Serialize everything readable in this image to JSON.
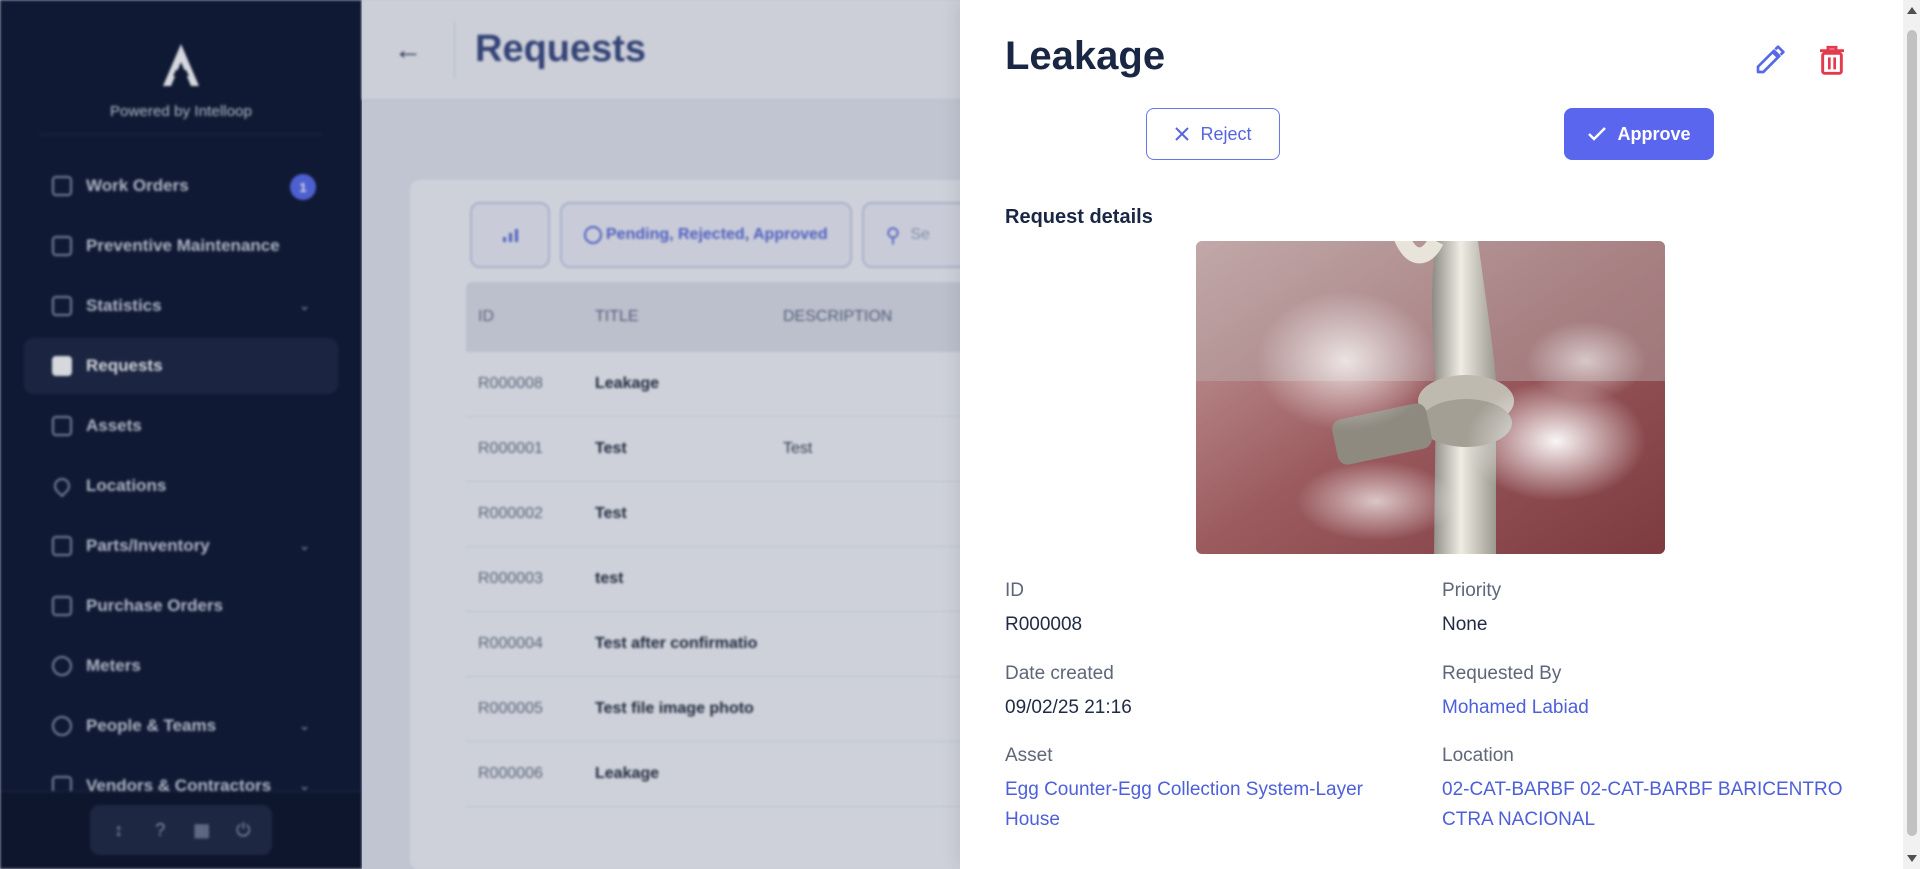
{
  "sidebar": {
    "powered_by": "Powered by Intelloop",
    "items": [
      {
        "label": "Work Orders",
        "badge": "1"
      },
      {
        "label": "Preventive Maintenance"
      },
      {
        "label": "Statistics"
      },
      {
        "label": "Requests"
      },
      {
        "label": "Assets"
      },
      {
        "label": "Locations"
      },
      {
        "label": "Parts/Inventory"
      },
      {
        "label": "Purchase Orders"
      },
      {
        "label": "Meters"
      },
      {
        "label": "People & Teams"
      },
      {
        "label": "Vendors & Contractors"
      }
    ],
    "bottom_icons": [
      "import-icon",
      "help-icon",
      "calendar-icon",
      "power-icon"
    ]
  },
  "main": {
    "title": "Requests",
    "filter_status": "Pending, Rejected, Approved",
    "search_placeholder": "Se",
    "columns": [
      "ID",
      "TITLE",
      "DESCRIPTION"
    ],
    "rows": [
      {
        "id": "R000008",
        "title": "Leakage",
        "desc": ""
      },
      {
        "id": "R000001",
        "title": "Test",
        "desc": "Test"
      },
      {
        "id": "R000002",
        "title": "Test",
        "desc": ""
      },
      {
        "id": "R000003",
        "title": "test",
        "desc": ""
      },
      {
        "id": "R000004",
        "title": "Test after confirmatio",
        "desc": ""
      },
      {
        "id": "R000005",
        "title": "Test file image photo",
        "desc": ""
      },
      {
        "id": "R000006",
        "title": "Leakage",
        "desc": ""
      }
    ]
  },
  "drawer": {
    "title": "Leakage",
    "reject_label": "Reject",
    "approve_label": "Approve",
    "section_title": "Request details",
    "fields": {
      "id": {
        "label": "ID",
        "value": "R000008"
      },
      "priority": {
        "label": "Priority",
        "value": "None"
      },
      "date_created": {
        "label": "Date created",
        "value": "09/02/25 21:16"
      },
      "requested_by": {
        "label": "Requested By",
        "value": "Mohamed Labiad"
      },
      "asset": {
        "label": "Asset",
        "value": "Egg Counter-Egg Collection System-Layer House"
      },
      "location": {
        "label": "Location",
        "value": "02-CAT-BARBF 02-CAT-BARBF BARICENTRO CTRA NACIONAL"
      }
    }
  },
  "colors": {
    "accent": "#5a66ee",
    "danger": "#e23b4e",
    "sidebar": "#0e1730"
  }
}
